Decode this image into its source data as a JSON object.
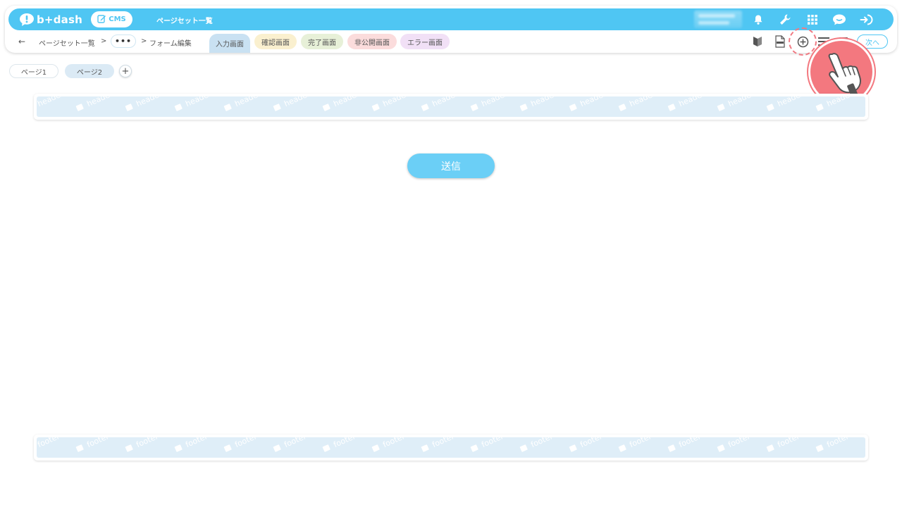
{
  "app": {
    "logo_text": "b+dash",
    "cms_label": "CMS",
    "title": "ページセット一覧"
  },
  "topbar": {
    "icons": [
      "bell-icon",
      "wrench-icon",
      "grid-icon",
      "support-icon",
      "logout-icon"
    ]
  },
  "breadcrumb": {
    "back": "←",
    "item1": "ページセット一覧",
    "sep1": ">",
    "more": "•••",
    "sep2": ">",
    "item2": "フォーム編集"
  },
  "tabs": [
    {
      "label": "入力画面",
      "color": "#c9e1f2",
      "active": true
    },
    {
      "label": "確認画面",
      "color": "#faf0cf"
    },
    {
      "label": "完了画面",
      "color": "#e7f0d8"
    },
    {
      "label": "非公開画面",
      "color": "#fbdcdc"
    },
    {
      "label": "エラー画面",
      "color": "#f1e0f6"
    }
  ],
  "toolbar": {
    "next_label": "次へ"
  },
  "pages": {
    "tabs": [
      "ページ1",
      "ページ2"
    ],
    "add": "+"
  },
  "canvas": {
    "header_label": "header",
    "footer_label": "footer",
    "submit_label": "送信"
  },
  "colors": {
    "accent": "#4fc6f3",
    "highlight": "#f3787f"
  }
}
